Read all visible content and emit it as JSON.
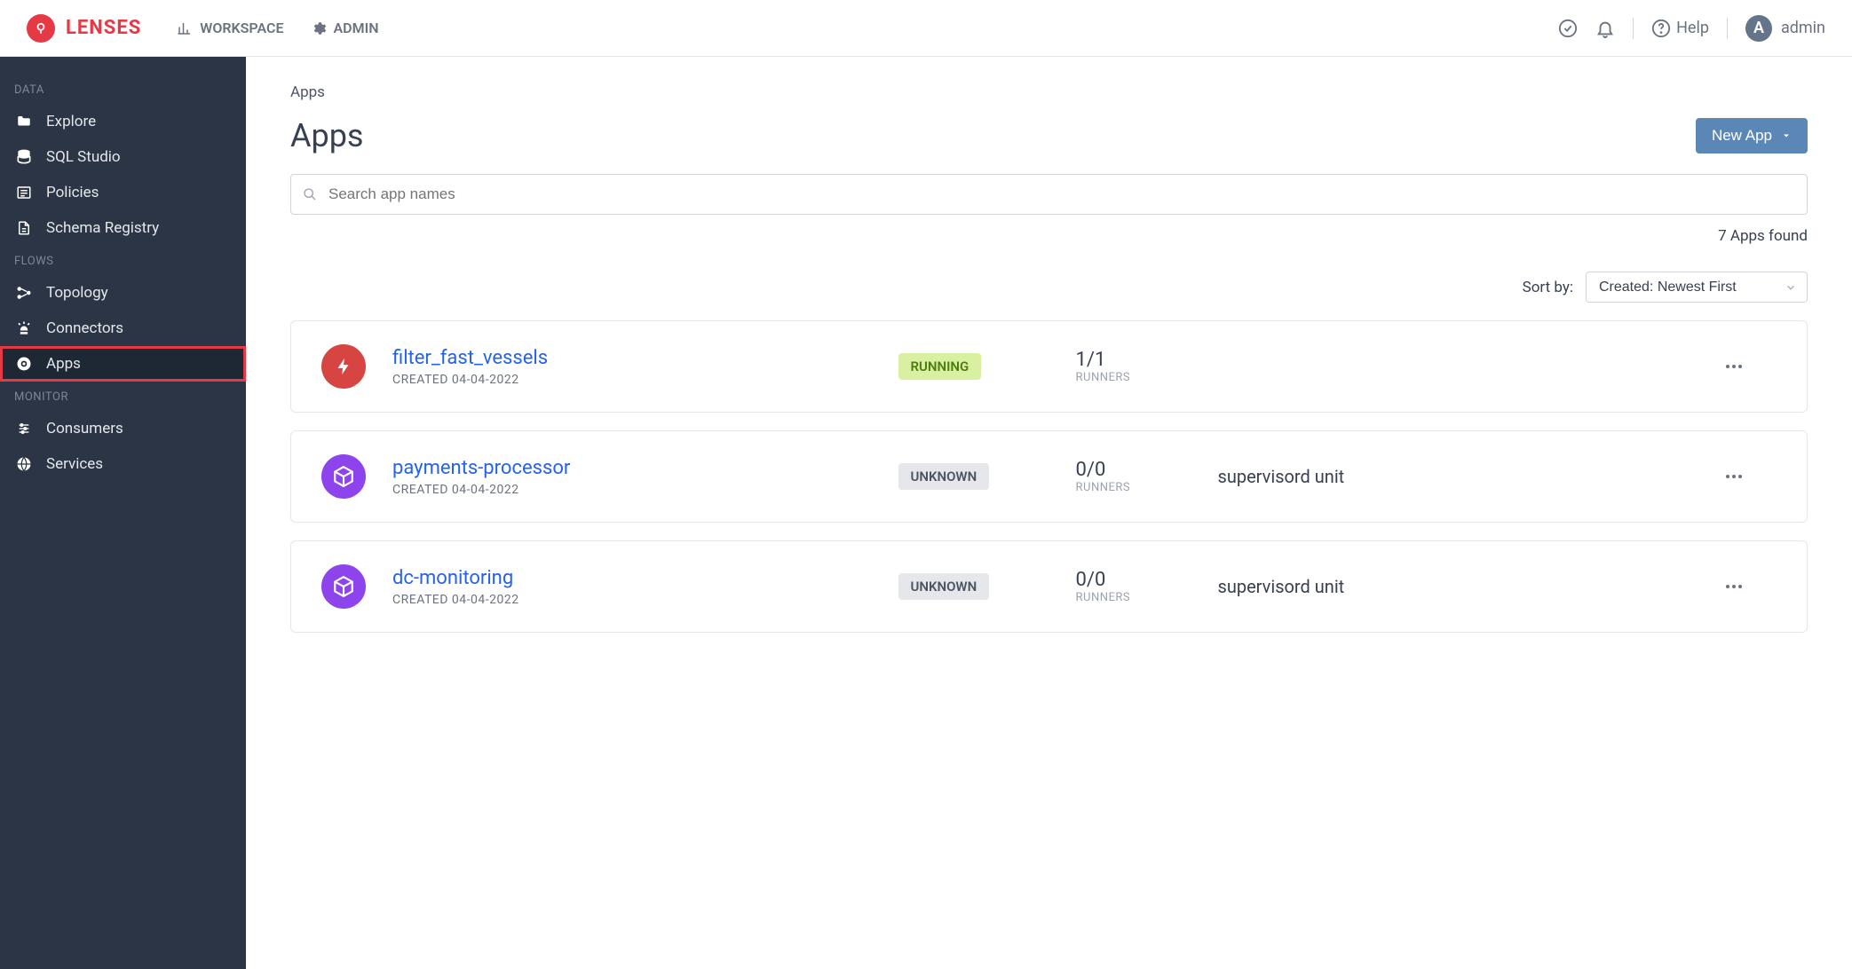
{
  "brand": "LENSES",
  "topnav": {
    "workspace": "WORKSPACE",
    "admin": "ADMIN"
  },
  "help_label": "Help",
  "user": {
    "initial": "A",
    "name": "admin"
  },
  "sidebar": {
    "sections": [
      {
        "label": "DATA",
        "items": [
          {
            "key": "explore",
            "label": "Explore"
          },
          {
            "key": "sqlstudio",
            "label": "SQL Studio"
          },
          {
            "key": "policies",
            "label": "Policies"
          },
          {
            "key": "schemaregistry",
            "label": "Schema Registry"
          }
        ]
      },
      {
        "label": "FLOWS",
        "items": [
          {
            "key": "topology",
            "label": "Topology"
          },
          {
            "key": "connectors",
            "label": "Connectors"
          },
          {
            "key": "apps",
            "label": "Apps",
            "active": true,
            "highlighted": true
          }
        ]
      },
      {
        "label": "MONITOR",
        "items": [
          {
            "key": "consumers",
            "label": "Consumers"
          },
          {
            "key": "services",
            "label": "Services"
          }
        ]
      }
    ]
  },
  "breadcrumb": "Apps",
  "page_title": "Apps",
  "new_app_label": "New App",
  "search_placeholder": "Search app names",
  "found_text": "7 Apps found",
  "sort_label": "Sort by:",
  "sort_value": "Created: Newest First",
  "runners_label": "RUNNERS",
  "created_prefix": "CREATED ",
  "apps": [
    {
      "name": "filter_fast_vessels",
      "created": "04-04-2022",
      "status": "RUNNING",
      "runners": "1/1",
      "extra": "",
      "icon": "bolt",
      "color": "red"
    },
    {
      "name": "payments-processor",
      "created": "04-04-2022",
      "status": "UNKNOWN",
      "runners": "0/0",
      "extra": "supervisord unit",
      "icon": "cube",
      "color": "purple"
    },
    {
      "name": "dc-monitoring",
      "created": "04-04-2022",
      "status": "UNKNOWN",
      "runners": "0/0",
      "extra": "supervisord unit",
      "icon": "cube",
      "color": "purple"
    }
  ]
}
